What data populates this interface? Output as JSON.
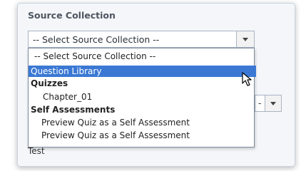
{
  "panel": {
    "label": "Source Collection",
    "select": {
      "value": "-- Select Source Collection --"
    },
    "dropdown": {
      "options": [
        {
          "label": "-- Select Source Collection --"
        },
        {
          "label": "Question Library"
        },
        {
          "label": "Quizzes"
        },
        {
          "label": "Chapter_01"
        },
        {
          "label": "Self Assessments"
        },
        {
          "label": "Preview Quiz as a Self Assessment"
        },
        {
          "label": "Preview Quiz as a Self Assessment"
        }
      ]
    },
    "second_select": {
      "value": "-"
    },
    "under_text": "Test"
  }
}
